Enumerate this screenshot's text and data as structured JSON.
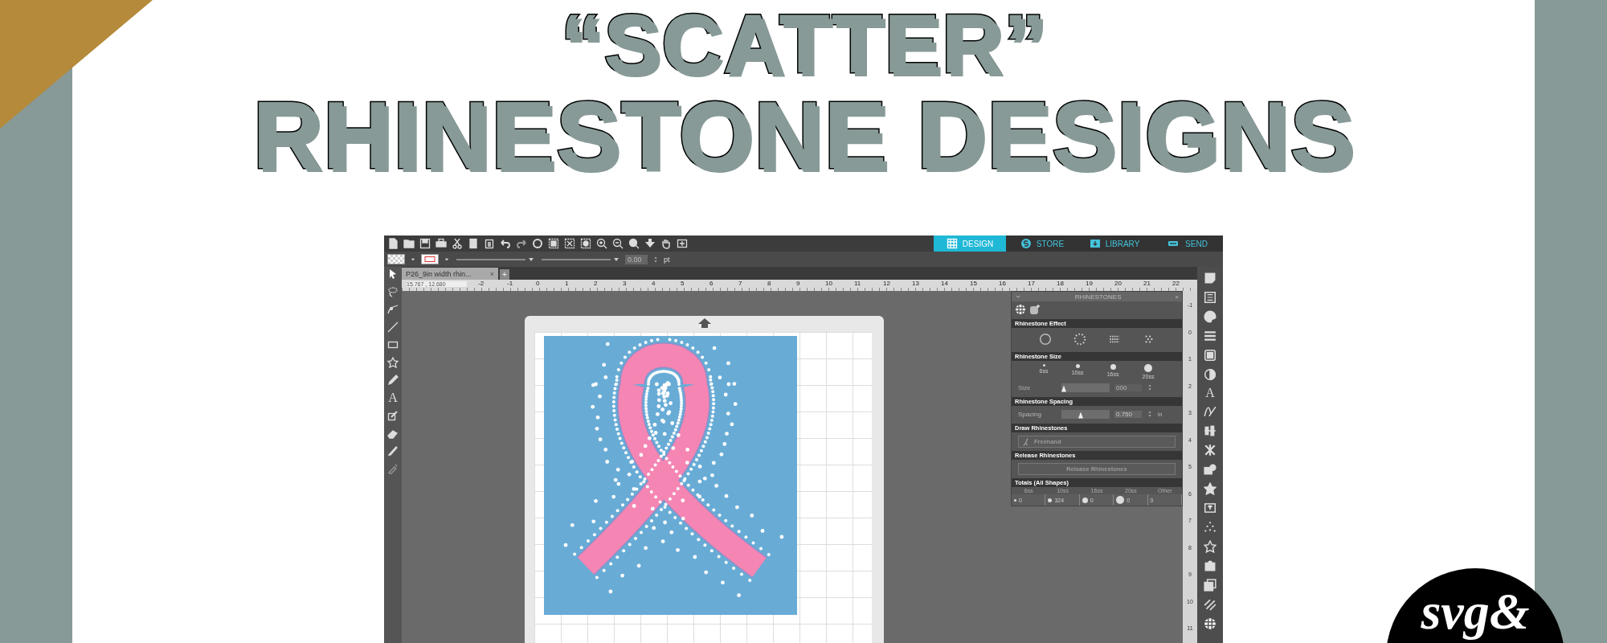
{
  "title": {
    "line_1": "“SCATTER”",
    "line_2": "RHINESTONE DESIGNS"
  },
  "app": {
    "nav_tabs": [
      {
        "label": "DESIGN",
        "kind": "design",
        "selected": true
      },
      {
        "label": "STORE",
        "kind": "store",
        "selected": false
      },
      {
        "label": "LIBRARY",
        "kind": "library",
        "selected": false
      },
      {
        "label": "SEND",
        "kind": "send",
        "selected": false
      }
    ],
    "line_width": {
      "value": "0.00",
      "unit": "pt"
    },
    "document_tab": {
      "label": "P26_9in width rhin...",
      "close": "×",
      "add": "+"
    },
    "ruler": {
      "cursor_position": "15.767 , 12.680",
      "labels": [
        "-2",
        "-1",
        "0",
        "1",
        "2",
        "3",
        "4",
        "5",
        "6",
        "7",
        "8",
        "9",
        "10",
        "11",
        "12",
        "13",
        "14",
        "15",
        "16",
        "17",
        "18",
        "19",
        "20",
        "21",
        "22"
      ]
    },
    "vertical_ruler": {
      "labels": [
        "-1",
        "0",
        "1",
        "2",
        "3",
        "4",
        "5",
        "6",
        "7",
        "8",
        "9",
        "10",
        "11"
      ]
    },
    "tool_glyphs": {
      "text_tool": "A",
      "text_style": "A"
    },
    "panel": {
      "title": "RHINESTONES",
      "close": "×",
      "effect": {
        "heading": "Rhinestone Effect"
      },
      "size": {
        "heading": "Rhinestone Size",
        "options": [
          "6ss",
          "10ss",
          "16ss",
          "20ss"
        ],
        "label": "Size",
        "level": 0.05,
        "value": "000"
      },
      "spacing": {
        "heading": "Rhinestone Spacing",
        "label": "Spacing",
        "level": 0.4,
        "value": "0.750",
        "unit": "in"
      },
      "draw": {
        "heading": "Draw Rhinestones",
        "button": "Freehand"
      },
      "release": {
        "heading": "Release Rhinestones",
        "button": "Release Rhinestones"
      },
      "totals": {
        "heading": "Totals (All Shapes)",
        "columns": [
          "6ss",
          "10ss",
          "16ss",
          "20ss",
          "Other"
        ],
        "values": [
          "0",
          "324",
          "0",
          "0",
          "0"
        ]
      }
    }
  },
  "logo": {
    "text": "svg&"
  }
}
